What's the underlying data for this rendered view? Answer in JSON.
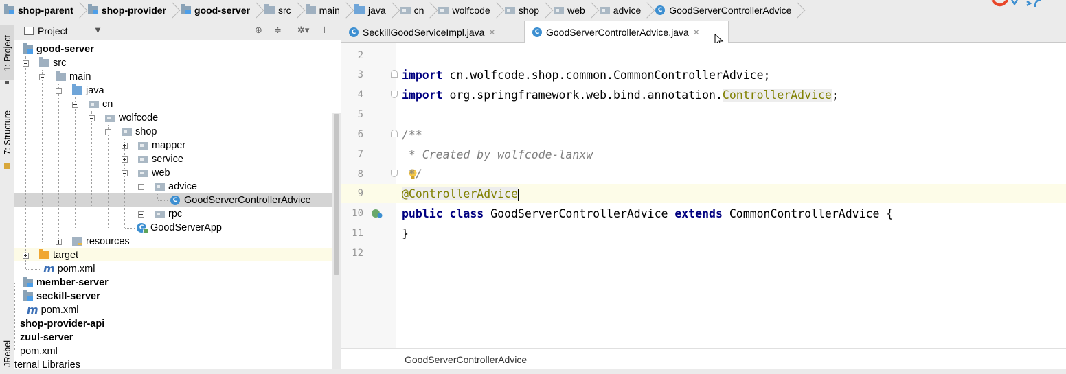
{
  "breadcrumb": {
    "items": [
      {
        "label": "shop-parent",
        "icon": "module-folder-icon",
        "bold": true
      },
      {
        "label": "shop-provider",
        "icon": "module-folder-icon",
        "bold": true
      },
      {
        "label": "good-server",
        "icon": "module-folder-icon",
        "bold": true
      },
      {
        "label": "src",
        "icon": "folder-icon",
        "bold": false
      },
      {
        "label": "main",
        "icon": "folder-icon",
        "bold": false
      },
      {
        "label": "java",
        "icon": "source-folder-icon",
        "bold": false
      },
      {
        "label": "cn",
        "icon": "package-icon",
        "bold": false
      },
      {
        "label": "wolfcode",
        "icon": "package-icon",
        "bold": false
      },
      {
        "label": "shop",
        "icon": "package-icon",
        "bold": false
      },
      {
        "label": "web",
        "icon": "package-icon",
        "bold": false
      },
      {
        "label": "advice",
        "icon": "package-icon",
        "bold": false
      },
      {
        "label": "GoodServerControllerAdvice",
        "icon": "class-icon",
        "bold": false
      }
    ]
  },
  "left_stripe": {
    "project_tab": "1: Project",
    "structure_tab": "7: Structure",
    "jrebel_tab": "JRebel"
  },
  "project_panel": {
    "title": "Project",
    "tree": [
      {
        "label": "good-server",
        "bold": true
      },
      {
        "label": "src"
      },
      {
        "label": "main"
      },
      {
        "label": "java"
      },
      {
        "label": "cn"
      },
      {
        "label": "wolfcode"
      },
      {
        "label": "shop"
      },
      {
        "label": "mapper"
      },
      {
        "label": "service"
      },
      {
        "label": "web"
      },
      {
        "label": "advice"
      },
      {
        "label": "GoodServerControllerAdvice",
        "selected": true
      },
      {
        "label": "rpc"
      },
      {
        "label": "GoodServerApp"
      },
      {
        "label": "resources"
      },
      {
        "label": "target"
      },
      {
        "label": "pom.xml"
      },
      {
        "label": "member-server",
        "bold": true
      },
      {
        "label": "seckill-server",
        "bold": true
      },
      {
        "label": "pom.xml"
      },
      {
        "label": "shop-provider-api",
        "bold": true
      },
      {
        "label": "zuul-server",
        "bold": true
      },
      {
        "label": "pom.xml"
      },
      {
        "label": "ternal Libraries"
      }
    ]
  },
  "tabs": [
    {
      "label": "SeckillGoodServiceImpl.java",
      "active": false
    },
    {
      "label": "GoodServerControllerAdvice.java",
      "active": true
    }
  ],
  "editor": {
    "line_numbers": [
      "2",
      "3",
      "4",
      "5",
      "6",
      "7",
      "8",
      "9",
      "10",
      "11",
      "12"
    ],
    "lines": {
      "l3_kw": "import",
      "l3_rest": " cn.wolfcode.shop.common.CommonControllerAdvice;",
      "l4_kw": "import",
      "l4_rest": " org.springframework.web.bind.annotation.",
      "l4_hl": "ControllerAdvice",
      "l4_end": ";",
      "l6": "/**",
      "l7": " * Created by wolfcode-lanxw",
      "l8": " */",
      "l9": "@ControllerAdvice",
      "l10_kw1": "public class",
      "l10_name": " GoodServerControllerAdvice ",
      "l10_kw2": "extends",
      "l10_rest": " CommonControllerAdvice {",
      "l11": "}"
    },
    "status_text": "GoodServerControllerAdvice"
  },
  "colors": {
    "keyword": "#000080",
    "comment": "#808080",
    "annotation": "#808000",
    "class_icon": "#3d8fd1",
    "selection": "#d4d4d4"
  }
}
